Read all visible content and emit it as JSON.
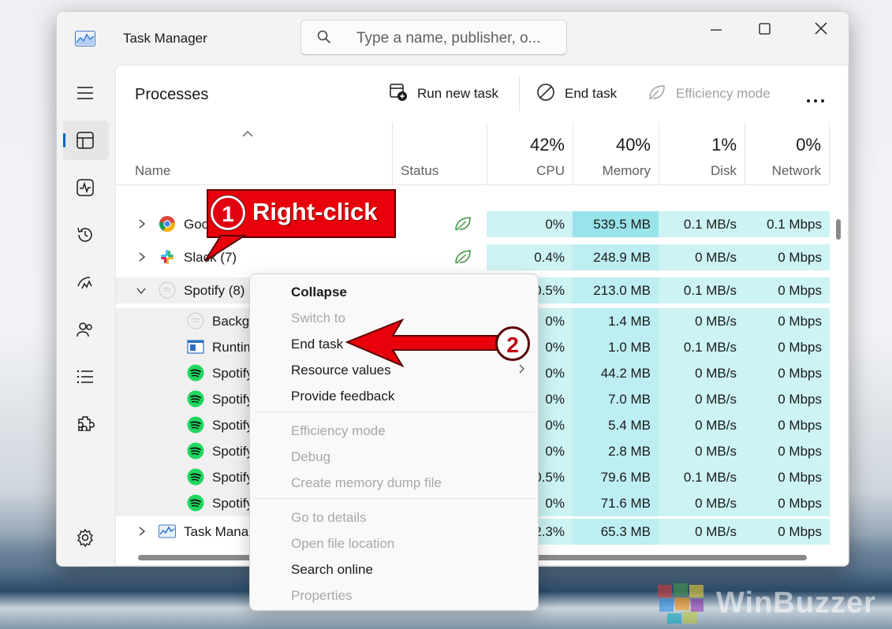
{
  "window": {
    "title": "Task Manager",
    "search_placeholder": "Type a name, publisher, o..."
  },
  "nav": {
    "items": [
      {
        "icon": "hamburger-icon"
      },
      {
        "icon": "processes-icon",
        "active": true
      },
      {
        "icon": "performance-icon"
      },
      {
        "icon": "app-history-icon"
      },
      {
        "icon": "startup-apps-icon"
      },
      {
        "icon": "users-icon"
      },
      {
        "icon": "details-icon"
      },
      {
        "icon": "services-icon"
      },
      {
        "icon": "settings-icon"
      }
    ]
  },
  "toolbar": {
    "page_title": "Processes",
    "run_new_task": "Run new task",
    "end_task": "End task",
    "efficiency_mode": "Efficiency mode"
  },
  "columns": {
    "name": "Name",
    "status": "Status",
    "cpu_pct": "42%",
    "cpu": "CPU",
    "memory_pct": "40%",
    "memory": "Memory",
    "disk_pct": "1%",
    "disk": "Disk",
    "network_pct": "0%",
    "network": "Network"
  },
  "rows": [
    {
      "name": "Goo",
      "expand": true,
      "icon": "chrome-icon",
      "cpu": "0%",
      "memory": "539.5 MB",
      "disk": "0.1 MB/s",
      "network": "0.1 Mbps",
      "efficiency": true
    },
    {
      "name": "Slack (7)",
      "expand": true,
      "icon": "slack-icon",
      "cpu": "0.4%",
      "memory": "248.9 MB",
      "disk": "0 MB/s",
      "network": "0 Mbps",
      "efficiency": true
    },
    {
      "name": "Spotify (8)",
      "expanded": true,
      "icon": "spotify-icon",
      "cpu": "0.5%",
      "memory": "213.0 MB",
      "disk": "0.1 MB/s",
      "network": "0 Mbps",
      "efficiency": true
    },
    {
      "name": "Background Task Host",
      "child": true,
      "icon": "spotify-icon",
      "cpu": "0%",
      "memory": "1.4 MB",
      "disk": "0 MB/s",
      "network": "0 Mbps"
    },
    {
      "name": "Runtime Broker",
      "child": true,
      "icon": "window-icon",
      "cpu": "0%",
      "memory": "1.0 MB",
      "disk": "0.1 MB/s",
      "network": "0 Mbps"
    },
    {
      "name": "Spotify",
      "child": true,
      "icon": "spotify-icon",
      "cpu": "0%",
      "memory": "44.2 MB",
      "disk": "0 MB/s",
      "network": "0 Mbps"
    },
    {
      "name": "Spotify",
      "child": true,
      "icon": "spotify-icon",
      "cpu": "0%",
      "memory": "7.0 MB",
      "disk": "0 MB/s",
      "network": "0 Mbps"
    },
    {
      "name": "Spotify",
      "child": true,
      "icon": "spotify-icon",
      "cpu": "0%",
      "memory": "5.4 MB",
      "disk": "0 MB/s",
      "network": "0 Mbps"
    },
    {
      "name": "Spotify",
      "child": true,
      "icon": "spotify-icon",
      "cpu": "0%",
      "memory": "2.8 MB",
      "disk": "0 MB/s",
      "network": "0 Mbps"
    },
    {
      "name": "Spotify",
      "child": true,
      "icon": "spotify-icon",
      "cpu": "0.5%",
      "memory": "79.6 MB",
      "disk": "0.1 MB/s",
      "network": "0 Mbps"
    },
    {
      "name": "Spotify",
      "child": true,
      "icon": "spotify-icon",
      "cpu": "0%",
      "memory": "71.6 MB",
      "disk": "0 MB/s",
      "network": "0 Mbps"
    },
    {
      "name": "Task Manager",
      "expand": true,
      "icon": "taskmanager-icon",
      "cpu": "2.3%",
      "memory": "65.3 MB",
      "disk": "0 MB/s",
      "network": "0 Mbps"
    }
  ],
  "context_menu": {
    "collapse": "Collapse",
    "switch_to": "Switch to",
    "end_task": "End task",
    "resource_values": "Resource values",
    "provide_feedback": "Provide feedback",
    "efficiency_mode": "Efficiency mode",
    "debug": "Debug",
    "create_dump": "Create memory dump file",
    "go_to_details": "Go to details",
    "open_file_location": "Open file location",
    "search_online": "Search online",
    "properties": "Properties"
  },
  "annotations": {
    "step1_number": "1",
    "step1_label": "Right-click",
    "step2_number": "2",
    "accent_color": "#e8000b"
  },
  "watermark": "WinBuzzer"
}
